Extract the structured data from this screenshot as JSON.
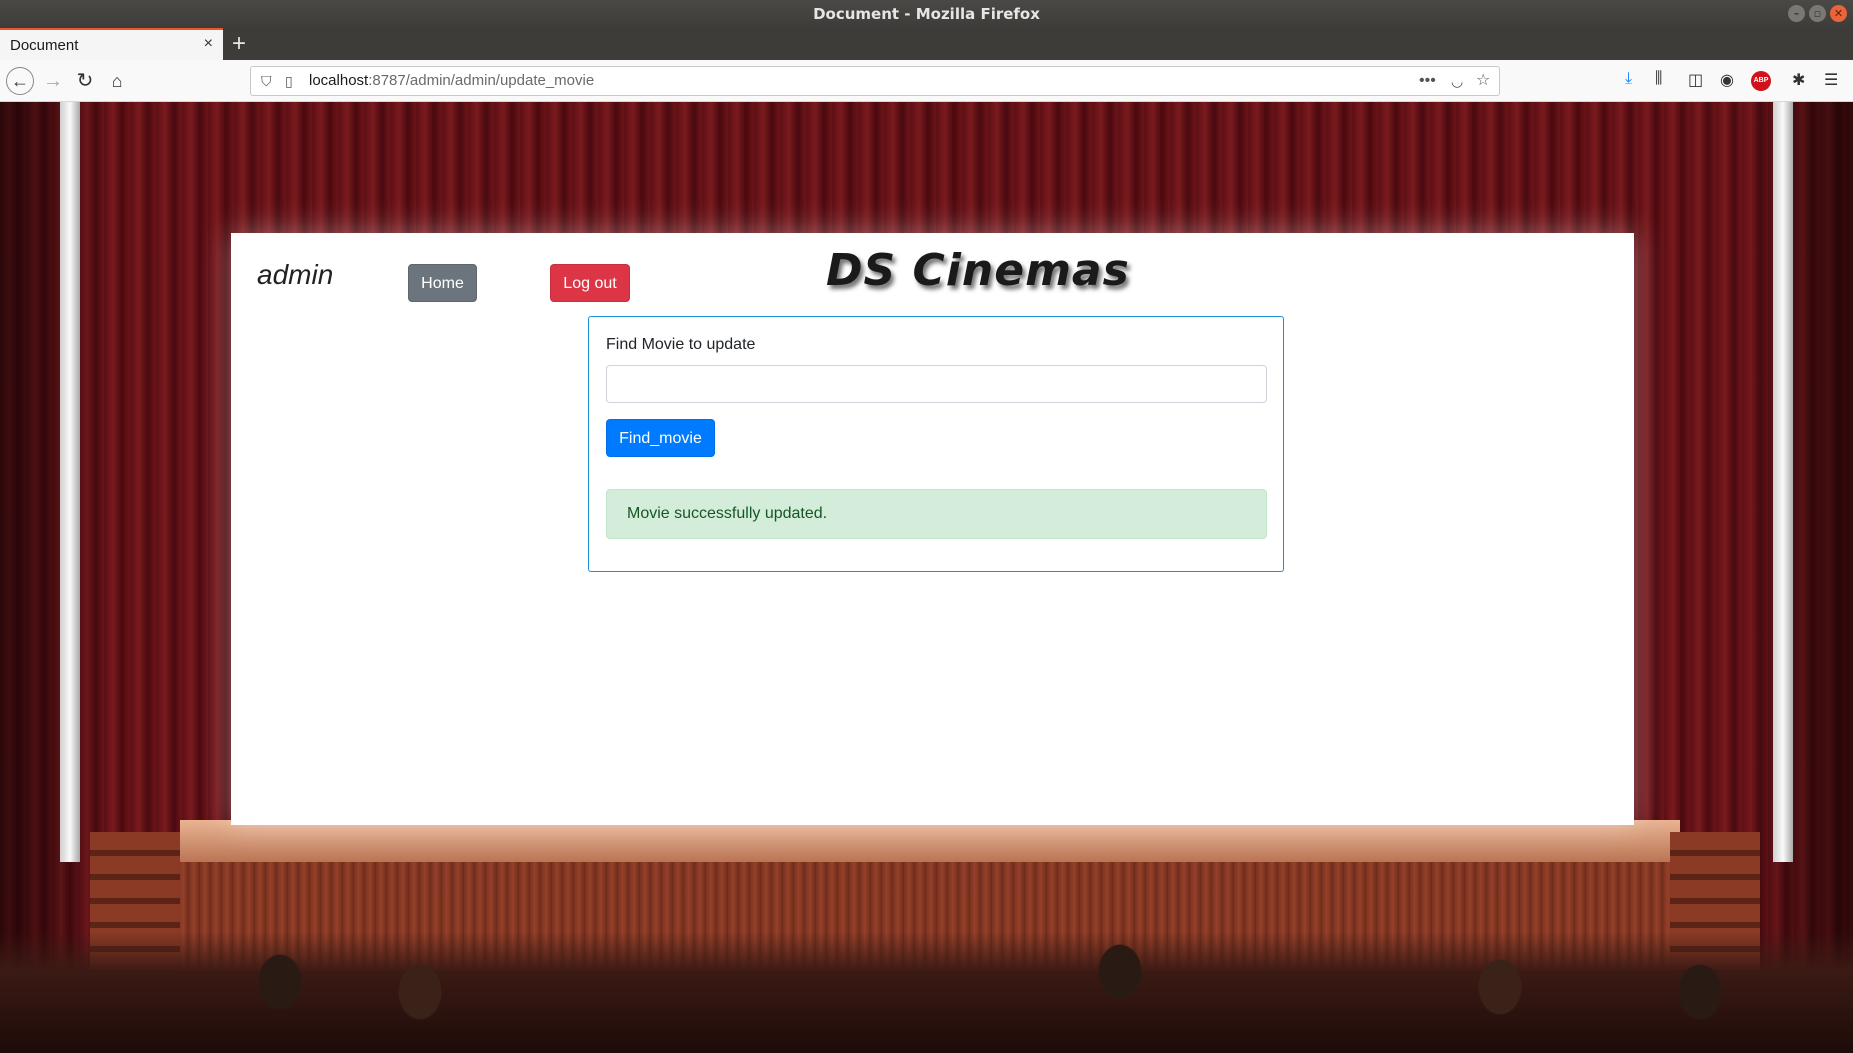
{
  "window": {
    "title": "Document - Mozilla Firefox"
  },
  "tab": {
    "title": "Document",
    "close_glyph": "×",
    "new_tab_glyph": "+"
  },
  "navigation": {
    "url_host": "localhost",
    "url_rest": ":8787/admin/admin/update_movie",
    "icons": [
      "back-icon",
      "forward-icon",
      "reload-icon",
      "home-icon",
      "shield-icon",
      "page-icon",
      "more-icon",
      "pocket-icon",
      "bookmark-star-icon",
      "download-icon",
      "library-icon",
      "sidebar-icon",
      "account-icon",
      "adblock-icon",
      "extensions-icon",
      "menu-icon"
    ],
    "abp_label": "ABP"
  },
  "header": {
    "user": "admin",
    "home_label": "Home",
    "logout_label": "Log out",
    "brand": "DS Cinemas"
  },
  "form": {
    "label": "Find Movie to update",
    "input_value": "",
    "input_placeholder": "",
    "submit_label": "Find_movie"
  },
  "alert": {
    "message": "Movie successfully updated."
  },
  "colors": {
    "home_button": "#6c757d",
    "logout_button": "#dc3545",
    "find_button": "#007bff",
    "card_border": "#1a8fd6",
    "alert_bg": "#d4edda",
    "alert_text": "#155724"
  }
}
